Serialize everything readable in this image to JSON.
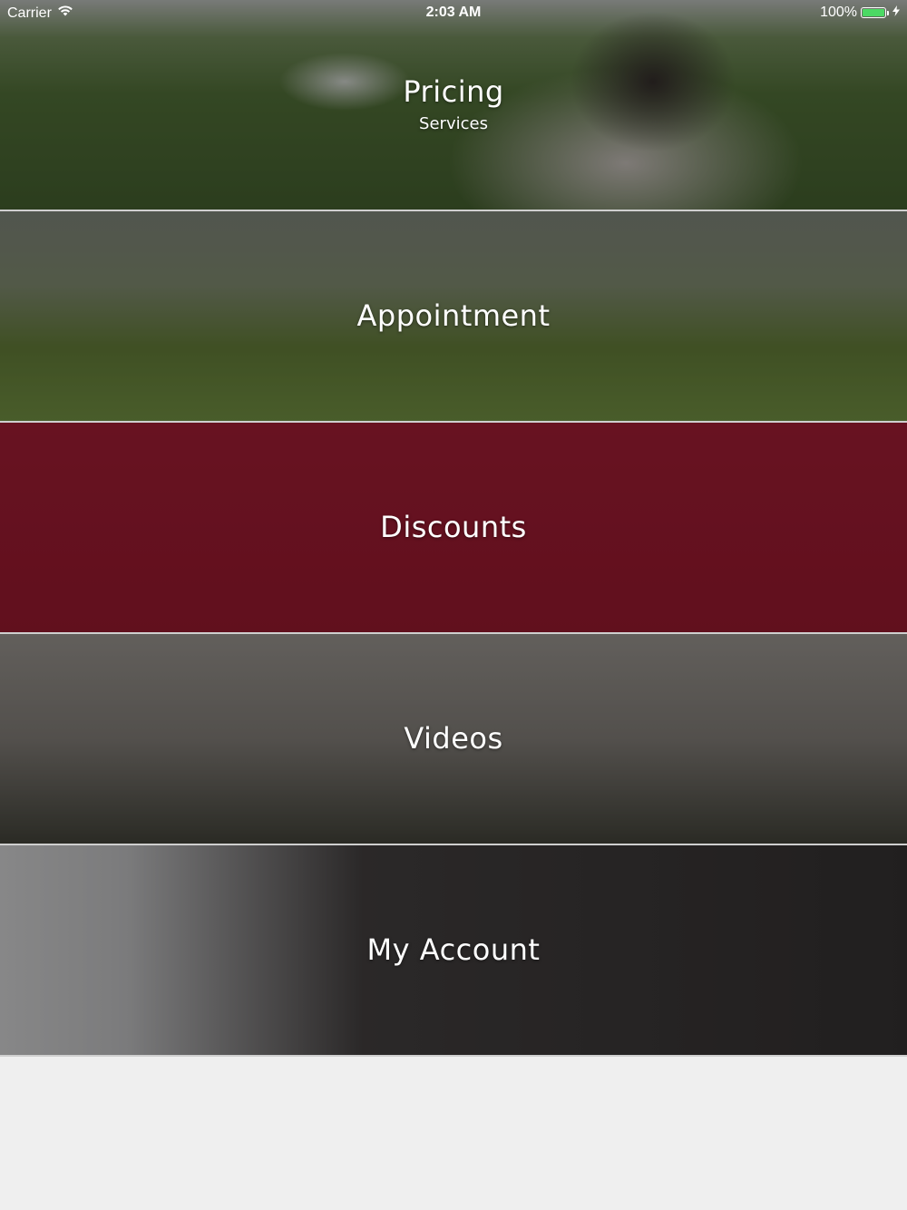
{
  "status_bar": {
    "carrier": "Carrier",
    "time": "2:03 AM",
    "battery_percent": "100%",
    "battery_level": 1.0,
    "battery_color": "#4cd964"
  },
  "menu": [
    {
      "title": "Pricing",
      "subtitle": "Services"
    },
    {
      "title": "Appointment"
    },
    {
      "title": "Discounts"
    },
    {
      "title": "Videos"
    },
    {
      "title": "My Account"
    }
  ],
  "colors": {
    "row_separator": "#cfcfcf",
    "page_background": "#efefef",
    "label_text": "#ffffff"
  },
  "icons": {
    "wifi": "wifi-icon",
    "battery": "battery-icon",
    "charging": "charging-bolt-icon"
  }
}
